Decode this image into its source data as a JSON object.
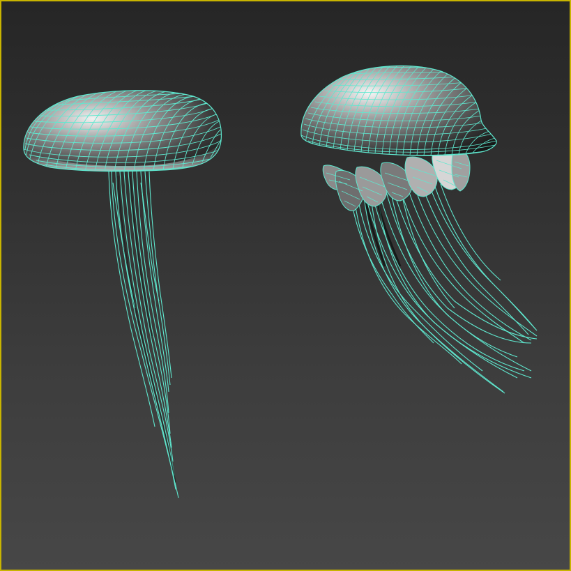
{
  "viewport": {
    "border_color": "#c8b400",
    "wire_color": "#5fe8cf",
    "shade_light": "#e8e8e8",
    "shade_dark": "#1c1c1c",
    "display_mode": "wireframe-over-shaded",
    "objects": [
      {
        "name": "jellyfish-1",
        "kind": "mushroom-cap jellyfish with long straight tentacles"
      },
      {
        "name": "jellyfish-2",
        "kind": "dome jellyfish with frilled arms and curved tentacles"
      }
    ]
  }
}
